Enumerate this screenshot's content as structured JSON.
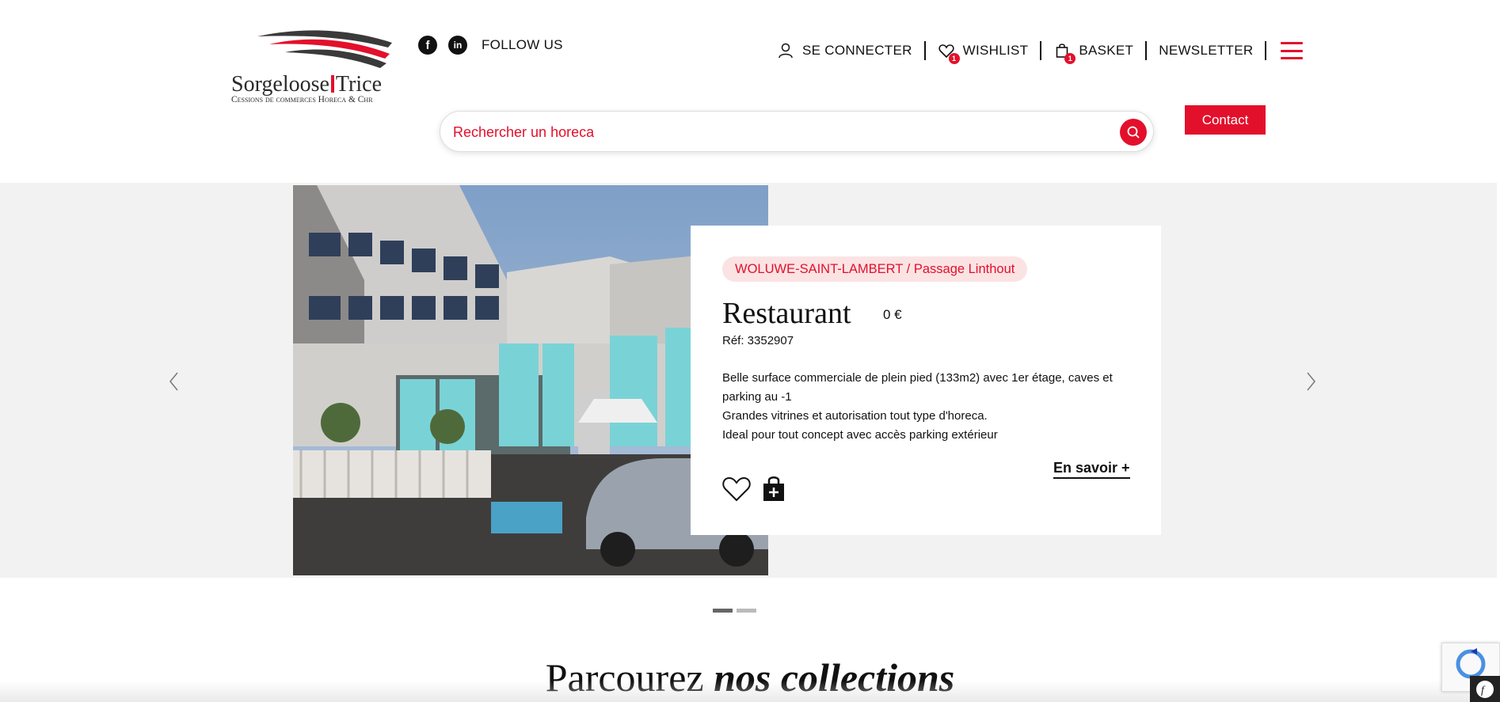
{
  "brand": {
    "name_left": "Sorgeloose",
    "name_right": "Trice",
    "tagline": "Cessions de commerces Horeca & Chr",
    "colors": {
      "accent": "#e3102b",
      "text": "#111111",
      "band": "#f2f2f2",
      "pill_bg": "#fbe3e4"
    }
  },
  "social": {
    "facebook_icon": "facebook-icon",
    "linkedin_icon": "linkedin-icon",
    "follow_label": "FOLLOW US"
  },
  "nav": {
    "login_label": "SE CONNECTER",
    "wishlist_label": "WISHLIST",
    "wishlist_count": "1",
    "basket_label": "BASKET",
    "basket_count": "1",
    "newsletter_label": "NEWSLETTER"
  },
  "search": {
    "placeholder": "Rechercher un horeca"
  },
  "contact_label": "Contact",
  "slide": {
    "location": "WOLUWE-SAINT-LAMBERT / Passage Linthout",
    "title": "Restaurant",
    "price": "0 €",
    "ref": "Réf: 3352907",
    "description": [
      "Belle surface commerciale de plein pied (133m2) avec 1er étage, caves et parking au -1",
      "Grandes vitrines et autorisation tout type d'horeca.",
      "Ideal pour tout concept avec accès parking extérieur"
    ],
    "more_label": "En savoir +",
    "image_alt": "building-facade-photo"
  },
  "slider": {
    "current": 1,
    "total": 2
  },
  "collections": {
    "prefix": "Parcourez",
    "emphasis": "nos collections"
  }
}
